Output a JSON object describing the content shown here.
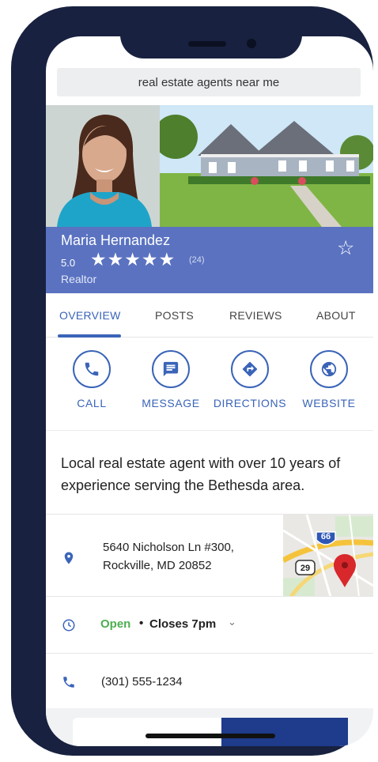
{
  "search": {
    "query": "real estate agents near me"
  },
  "agent": {
    "name": "Maria Hernandez",
    "rating": "5.0",
    "stars": "★★★★★",
    "review_count": "(24)",
    "category": "Realtor",
    "save_icon": "☆"
  },
  "tabs": [
    {
      "label": "OVERVIEW",
      "active": true
    },
    {
      "label": "POSTS",
      "active": false
    },
    {
      "label": "REVIEWS",
      "active": false
    },
    {
      "label": "ABOUT",
      "active": false
    }
  ],
  "actions": [
    {
      "label": "CALL",
      "icon": "phone-icon"
    },
    {
      "label": "MESSAGE",
      "icon": "message-icon"
    },
    {
      "label": "DIRECTIONS",
      "icon": "directions-icon"
    },
    {
      "label": "WEBSITE",
      "icon": "globe-icon"
    }
  ],
  "description": "Local real estate agent with over 10 years of experience serving the Bethesda area.",
  "address": {
    "line1": "5640 Nicholson Ln #300,",
    "line2": "Rockville, MD 20852"
  },
  "map": {
    "route_66": "66",
    "route_29": "29"
  },
  "hours": {
    "status": "Open",
    "separator": "•",
    "closes": "Closes 7pm",
    "chevron": "⌄"
  },
  "phone": {
    "number": "(301) 555-1234"
  },
  "colors": {
    "brand_blue": "#3a64b8",
    "band": "#5a72c0",
    "frame": "#18213f",
    "open_green": "#4caf50",
    "pin_red": "#d8282c"
  }
}
